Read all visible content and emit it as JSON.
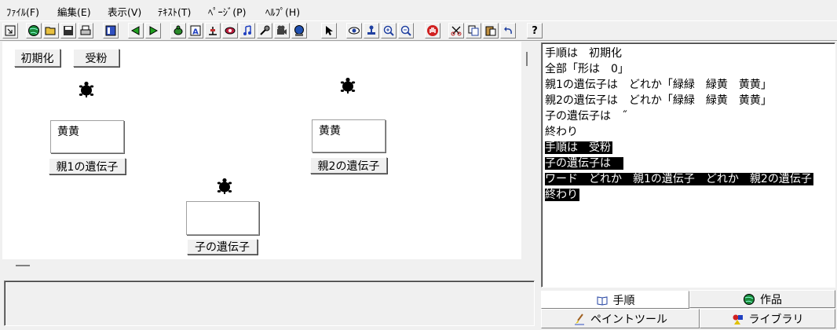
{
  "menu": [
    "ﾌｧｲﾙ(F)",
    "編集(E)",
    "表示(V)",
    "ﾃｷｽﾄ(T)",
    "ﾍﾟｰｼﾞ(P)",
    "ﾍﾙﾌﾟ(H)"
  ],
  "toolbar": {
    "help_label": "?"
  },
  "stage": {
    "init_button": "初期化",
    "pollinate_button": "受粉",
    "parent1_gene": "黄黄",
    "parent1_label": "親1の遺伝子",
    "parent2_gene": "黄黄",
    "parent2_label": "親2の遺伝子",
    "child_gene": "",
    "child_label": "子の遺伝子"
  },
  "editor": {
    "lines": [
      "手順は　初期化",
      "全部「形は　0」",
      "親1の遺伝子は　どれか「緑緑　緑黄　黄黄」",
      "親2の遺伝子は　どれか「緑緑　緑黄　黄黄」",
      "子の遺伝子は　˝",
      "終わり",
      "手順は　受粉",
      "子の遺伝子は　",
      "ワード　どれか　親1の遺伝子　どれか　親2の遺伝子",
      "終わり"
    ]
  },
  "tabs": {
    "procedure": "手順",
    "works": "作品",
    "paint_tool": "ペイントツール",
    "library": "ライブラリ"
  },
  "colors": {
    "selection_bg": "#000000",
    "window_bg": "#f0f0f0"
  }
}
